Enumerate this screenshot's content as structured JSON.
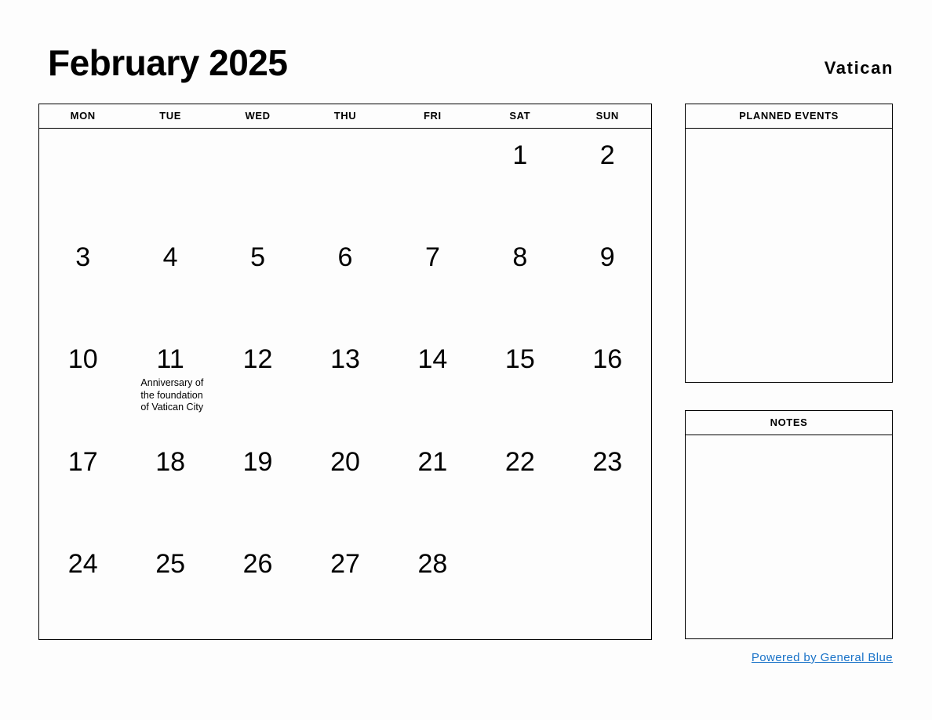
{
  "header": {
    "month_title": "February 2025",
    "country": "Vatican"
  },
  "calendar": {
    "weekdays": [
      "MON",
      "TUE",
      "WED",
      "THU",
      "FRI",
      "SAT",
      "SUN"
    ],
    "weeks": [
      [
        {
          "day": "",
          "events": []
        },
        {
          "day": "",
          "events": []
        },
        {
          "day": "",
          "events": []
        },
        {
          "day": "",
          "events": []
        },
        {
          "day": "",
          "events": []
        },
        {
          "day": "1",
          "events": []
        },
        {
          "day": "2",
          "events": []
        }
      ],
      [
        {
          "day": "3",
          "events": []
        },
        {
          "day": "4",
          "events": []
        },
        {
          "day": "5",
          "events": []
        },
        {
          "day": "6",
          "events": []
        },
        {
          "day": "7",
          "events": []
        },
        {
          "day": "8",
          "events": []
        },
        {
          "day": "9",
          "events": []
        }
      ],
      [
        {
          "day": "10",
          "events": []
        },
        {
          "day": "11",
          "events": [
            "Anniversary of the foundation of Vatican City"
          ]
        },
        {
          "day": "12",
          "events": []
        },
        {
          "day": "13",
          "events": []
        },
        {
          "day": "14",
          "events": []
        },
        {
          "day": "15",
          "events": []
        },
        {
          "day": "16",
          "events": []
        }
      ],
      [
        {
          "day": "17",
          "events": []
        },
        {
          "day": "18",
          "events": []
        },
        {
          "day": "19",
          "events": []
        },
        {
          "day": "20",
          "events": []
        },
        {
          "day": "21",
          "events": []
        },
        {
          "day": "22",
          "events": []
        },
        {
          "day": "23",
          "events": []
        }
      ],
      [
        {
          "day": "24",
          "events": []
        },
        {
          "day": "25",
          "events": []
        },
        {
          "day": "26",
          "events": []
        },
        {
          "day": "27",
          "events": []
        },
        {
          "day": "28",
          "events": []
        },
        {
          "day": "",
          "events": []
        },
        {
          "day": "",
          "events": []
        }
      ]
    ]
  },
  "panels": {
    "planned_events": {
      "title": "PLANNED EVENTS",
      "content": ""
    },
    "notes": {
      "title": "NOTES",
      "content": ""
    }
  },
  "footer": {
    "link_text": "Powered by General Blue"
  },
  "colors": {
    "link": "#1a73c8",
    "border": "#000000",
    "background": "#fdfdfd",
    "text": "#000000"
  }
}
